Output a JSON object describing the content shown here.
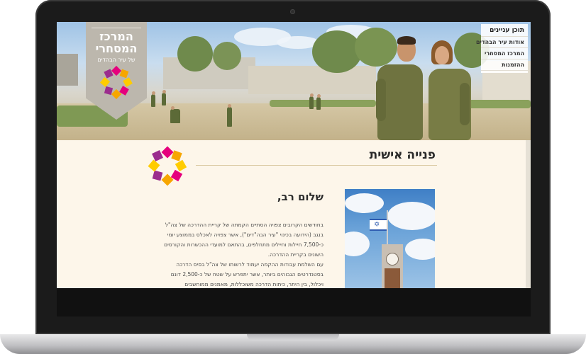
{
  "site": {
    "logo": {
      "title_line1": "המרכז",
      "title_line2": "המסחרי",
      "subtitle": "של עיר הבהדים",
      "colors": [
        "#e5007d",
        "#f7a600",
        "#9b2d8e",
        "#ffcc00"
      ]
    },
    "top_menu": [
      {
        "label": "תוכן עניינים",
        "active": true
      },
      {
        "label": "אודות עיר הבהדים",
        "active": false
      },
      {
        "label": "המרכז המסחרי",
        "active": false
      },
      {
        "label": "ההזמנות",
        "active": false
      }
    ]
  },
  "content": {
    "heading": "פנייה אישית",
    "greeting": "שלום רב,",
    "paragraphs": [
      "בחודשים הקרובים צפויה הסתיים הקמתה של קריית ההדרכה של צה\"ל בנגב (הידועה בכינוי \"עיר הבה\"דים\"), אשר צפויה לאכלס בממוצע יומי כ-7,500 חיילות וחיילים מתחלפים, בהתאם למועדי ההכשרות והקורסים השונים בקריית ההדרכה.",
      "עם השלמת עבודות ההקמה יעמוד לרשותו של צה\"ל בסיס הדרכה בסטנדרטים הגבוהים ביותר, אשר יתפרש על שטח של כ-2,500 דונם ויכלול, בין היתר, כיתות הדרכה משוכללות, מאמנים ממוחשבים (סימולטורים), מרכז ספורט, אולם אירועים וכנסים, הכל בהתאם לצרכי ההדרכה של"
    ]
  },
  "colors": {
    "page_background": "#fdf6ea",
    "heading_rule": "#d9c8a0",
    "shield": "#bcb7ad"
  }
}
